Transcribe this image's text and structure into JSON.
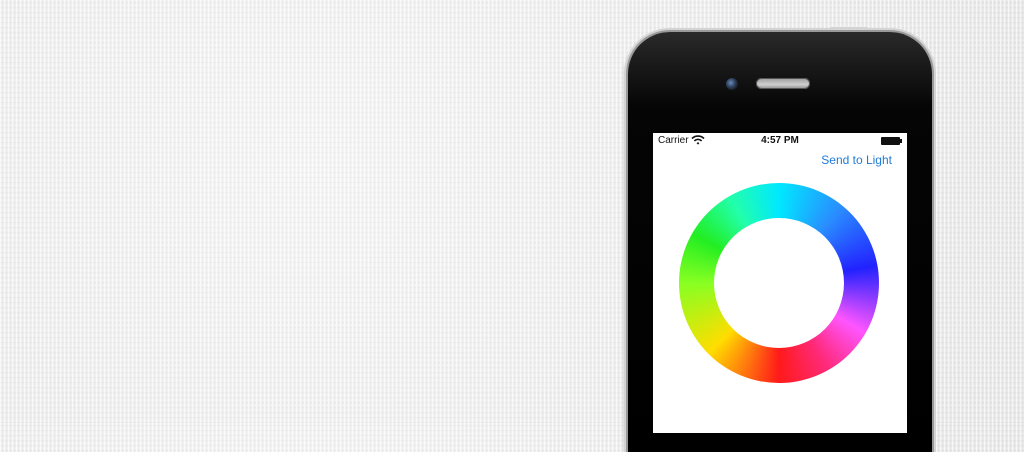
{
  "status_bar": {
    "carrier": "Carrier",
    "time": "4:57 PM",
    "wifi_icon": "wifi-icon",
    "battery_icon": "battery-icon"
  },
  "nav": {
    "send_button": "Send to Light"
  },
  "colors": {
    "accent": "#1f7bd8"
  }
}
